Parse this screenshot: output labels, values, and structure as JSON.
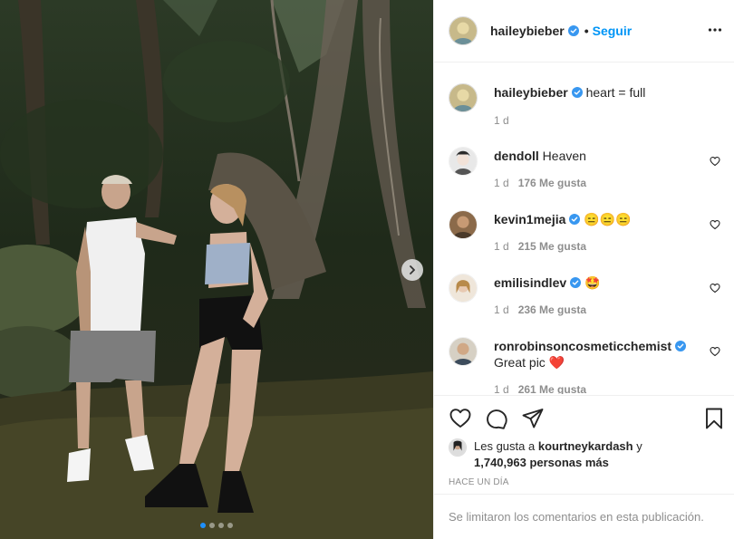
{
  "post": {
    "username": "haileybieber",
    "follow_label": "Seguir",
    "separator": "•",
    "caption": "heart = full",
    "caption_time": "1 d"
  },
  "comments": [
    {
      "user": "dendoll",
      "text": "Heaven",
      "time": "1 d",
      "likes": "176 Me gusta",
      "verified": false
    },
    {
      "user": "kevin1mejia",
      "text": "😑😑😑",
      "time": "1 d",
      "likes": "215 Me gusta",
      "verified": true
    },
    {
      "user": "emilisindlev",
      "text": "🤩",
      "time": "1 d",
      "likes": "236 Me gusta",
      "verified": true
    },
    {
      "user": "ronrobinsoncosmeticchemist",
      "text": "Great pic ❤️",
      "time": "1 d",
      "likes": "261 Me gusta",
      "verified": true
    }
  ],
  "likes": {
    "prefix": "Les gusta a",
    "user": "kourtneykardash",
    "conj": "y",
    "count": "1,740,963 personas más"
  },
  "timestamp": "HACE UN DÍA",
  "comments_limited": "Se limitaron los comentarios en esta publicación.",
  "carousel": {
    "count": 4,
    "active": 1
  },
  "colors": {
    "accent": "#0095f6",
    "verified": "#3897f0",
    "text": "#262626",
    "muted": "#8e8e8e"
  },
  "icons": [
    "heart-icon",
    "comment-icon",
    "share-icon",
    "bookmark-icon",
    "more-icon",
    "chevron-right-icon",
    "verified-icon"
  ]
}
